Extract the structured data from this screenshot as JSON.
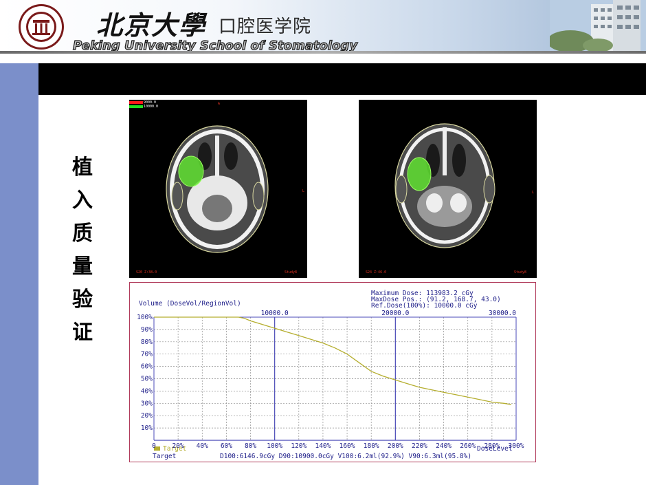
{
  "header": {
    "brand_cn": "北京大學",
    "school_cn": "口腔医学院",
    "brand_en": "Peking University School of Stomatology"
  },
  "slide": {
    "vertical_title_chars": [
      "植",
      "入",
      "质",
      "量",
      "验",
      "证"
    ]
  },
  "ct_panels": [
    {
      "legend_top": "9000.0",
      "legend_bottom": "10000.0",
      "top_marker": "A",
      "side_marker": "L",
      "bottom_left": "S20  Z:38.0",
      "bottom_right": "Study8"
    },
    {
      "side_marker": "L",
      "bottom_left": "S24  Z:46.0",
      "bottom_right": "Study8"
    }
  ],
  "dvh": {
    "ylabel": "Volume (DoseVol/RegionVol)",
    "max_dose": "Maximum Dose: 113983.2 cGy",
    "max_dose_pos": "MaxDose Pos.: (91.2, 168.7, 43.0)",
    "ref_dose": "Ref.Dose(100%):  10000.0 cGy",
    "xlabel": "DoseLevel",
    "legend_label": "Target",
    "summary_name": "Target",
    "summary_stats": "D100:6146.9cGy D90:10900.0cGy V100:6.2ml(92.9%) V90:6.3ml(95.8%)"
  },
  "chart_data": {
    "type": "line",
    "title": "",
    "ylabel": "Volume (DoseVol/RegionVol)",
    "xlabel": "DoseLevel",
    "x_ticks": [
      "0",
      "20%",
      "40%",
      "60%",
      "80%",
      "100%",
      "120%",
      "140%",
      "160%",
      "180%",
      "200%",
      "220%",
      "240%",
      "260%",
      "280%",
      "300%"
    ],
    "y_ticks": [
      "100%",
      "90%",
      "80%",
      "70%",
      "60%",
      "50%",
      "40%",
      "30%",
      "20%",
      "10%"
    ],
    "top_ticks": [
      "10000.0",
      "20000.0",
      "30000.0"
    ],
    "xlim": [
      0,
      300
    ],
    "ylim": [
      0,
      100
    ],
    "grid": true,
    "series": [
      {
        "name": "Target",
        "color": "#b5ae2f",
        "x": [
          0,
          60,
          70,
          75,
          80,
          90,
          100,
          110,
          120,
          130,
          140,
          150,
          160,
          170,
          180,
          190,
          200,
          210,
          220,
          230,
          240,
          250,
          260,
          270,
          280,
          290,
          296
        ],
        "y": [
          100,
          100,
          100,
          99,
          97,
          94,
          91,
          88,
          85,
          82,
          79,
          75,
          70,
          63,
          56,
          52,
          49,
          46,
          43,
          41,
          39,
          37,
          35,
          33,
          31,
          30,
          29
        ]
      }
    ],
    "vertical_markers": [
      100,
      200
    ],
    "colors": {
      "grid": "#8f8f8f",
      "axis": "#4a4ab8",
      "text": "#20208a",
      "frame": "#b03a5a"
    }
  }
}
